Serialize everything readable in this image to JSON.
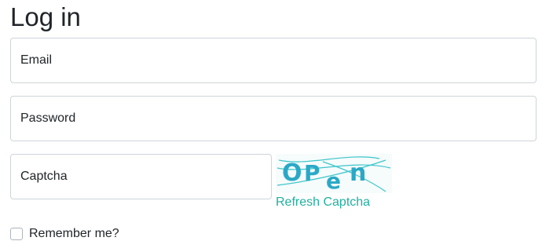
{
  "page": {
    "title": "Log in"
  },
  "form": {
    "email": {
      "placeholder": "Email",
      "value": ""
    },
    "password": {
      "placeholder": "Password",
      "value": ""
    },
    "captcha": {
      "placeholder": "Captcha",
      "value": ""
    },
    "captcha_image": {
      "text": "OPen",
      "characters": [
        "O",
        "P",
        "e",
        "n"
      ],
      "text_color": "#2aa9c6",
      "noise_color": "#3cc6cc"
    },
    "refresh_link": "Refresh Captcha",
    "remember_me": {
      "label": "Remember me?",
      "checked": false
    }
  },
  "colors": {
    "link": "#20b0a0",
    "border": "#ced4da",
    "text": "#212529"
  }
}
